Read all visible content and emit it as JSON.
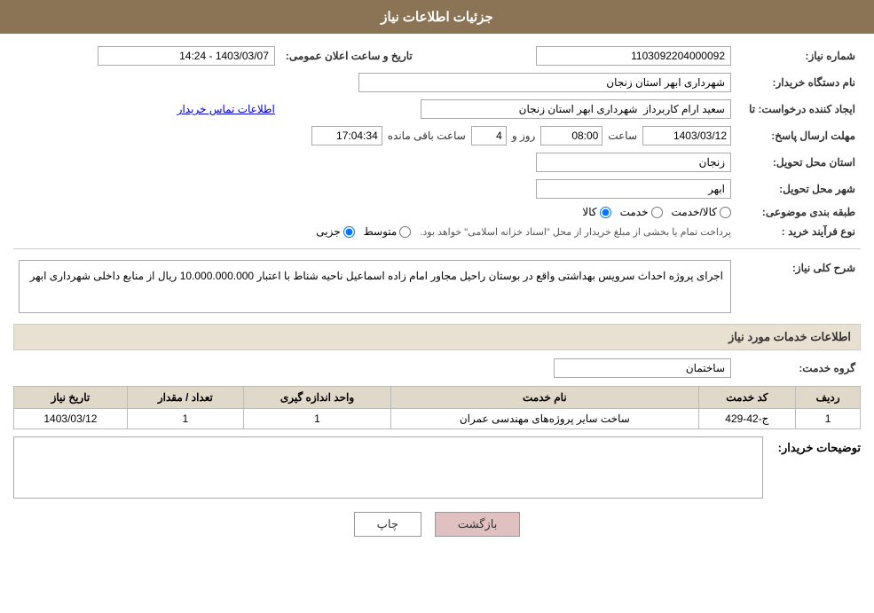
{
  "header": {
    "title": "جزئیات اطلاعات نیاز"
  },
  "fields": {
    "need_number_label": "شماره نیاز:",
    "need_number_value": "1103092204000092",
    "announce_date_label": "تاریخ و ساعت اعلان عمومی:",
    "announce_date_value": "1403/03/07 - 14:24",
    "buyer_org_label": "نام دستگاه خریدار:",
    "buyer_org_value": "شهرداری ابهر استان زنجان",
    "creator_label": "ایجاد کننده درخواست: تا",
    "creator_value": "سعید ارام کاربرداز  شهرداری ابهر استان زنجان",
    "contact_info_link": "اطلاعات تماس خریدار",
    "response_deadline_label": "مهلت ارسال پاسخ:",
    "response_date": "1403/03/12",
    "response_time_label": "ساعت",
    "response_time": "08:00",
    "response_days_label": "روز و",
    "response_days": "4",
    "response_remaining_label": "ساعت باقی مانده",
    "response_remaining": "17:04:34",
    "province_label": "استان محل تحویل:",
    "province_value": "زنجان",
    "city_label": "شهر محل تحویل:",
    "city_value": "ابهر",
    "category_label": "طبقه بندی موضوعی:",
    "category_kala": "کالا",
    "category_khadamat": "خدمت",
    "category_kala_khadamat": "کالا/خدمت",
    "process_label": "نوع فرآیند خرید :",
    "process_jozei": "جزیی",
    "process_motavaset": "متوسط",
    "process_note": "پرداخت تمام یا بخشی از مبلغ خریدار از محل \"اسناد خزانه اسلامی\" خواهد بود.",
    "description_label": "شرح کلی نیاز:",
    "description_text": "اجرای پروژه احداث سرویس بهداشتی واقع در بوستان راحیل مجاور امام زاده اسماعیل ناحیه شناط با اعتبار 10.000.000.000 ریال از منابع داخلی شهرداری ابهر",
    "services_section_label": "اطلاعات خدمات مورد نیاز",
    "service_group_label": "گروه خدمت:",
    "service_group_value": "ساختمان",
    "table_headers": {
      "row_num": "ردیف",
      "service_code": "کد خدمت",
      "service_name": "نام خدمت",
      "unit": "واحد اندازه گیری",
      "quantity": "تعداد / مقدار",
      "date": "تاریخ نیاز"
    },
    "table_rows": [
      {
        "row_num": "1",
        "service_code": "ج-42-429",
        "service_name": "ساخت سایر پروژه‌های مهندسی عمران",
        "unit": "1",
        "quantity": "1",
        "date": "1403/03/12"
      }
    ],
    "buyer_notes_label": "توضیحات خریدار:",
    "buyer_notes_value": ""
  },
  "buttons": {
    "print_label": "چاپ",
    "back_label": "بازگشت"
  }
}
